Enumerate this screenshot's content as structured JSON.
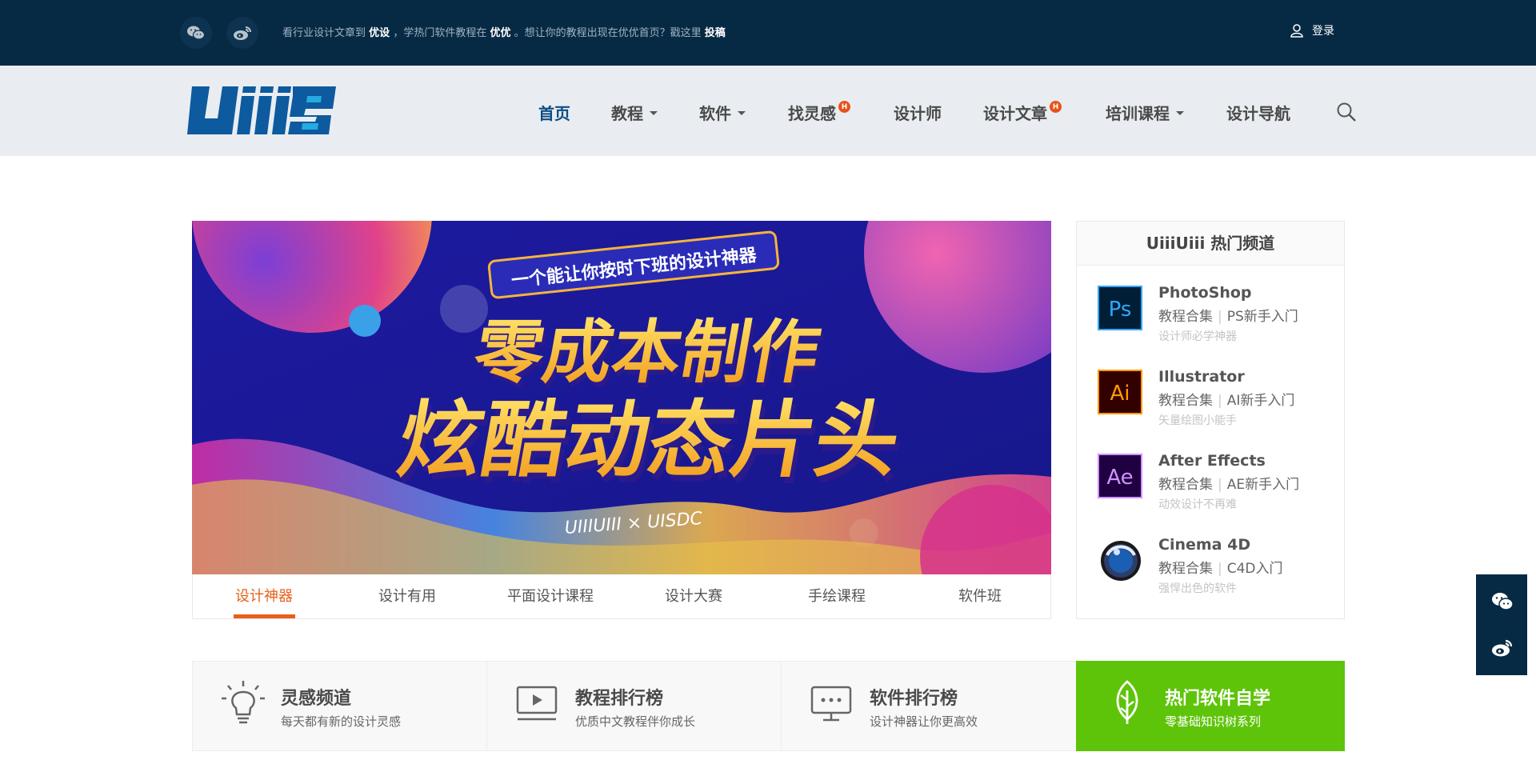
{
  "topbar": {
    "notice": {
      "p1": "看行业设计文章到",
      "b1": "优设",
      "p2": "，学热门软件教程在",
      "b2": "优优",
      "p3": "。想让你的教程出现在优优首页？戳这里",
      "b3": "投稿"
    },
    "login_label": "登录"
  },
  "nav": {
    "items": [
      {
        "label": "首页"
      },
      {
        "label": "教程"
      },
      {
        "label": "软件"
      },
      {
        "label": "找灵感"
      },
      {
        "label": "设计师"
      },
      {
        "label": "设计文章"
      },
      {
        "label": "培训课程"
      },
      {
        "label": "设计导航"
      }
    ],
    "hot_badge": "H"
  },
  "banner": {
    "top_pill": "一个能让你按时下班的设计神器",
    "line1": "零成本制作",
    "line2": "炫酷动态片头",
    "footer": "UIIIUIII × UISDC"
  },
  "tabs": [
    "设计神器",
    "设计有用",
    "平面设计课程",
    "设计大赛",
    "手绘课程",
    "软件班"
  ],
  "hot_panel": {
    "title": "UiiiUiii 热门频道",
    "channels": [
      {
        "icon_text": "Ps",
        "title": "PhotoShop",
        "link1": "教程合集",
        "link2": "PS新手入门",
        "sub": "设计师必学神器",
        "color": "#31a8ff",
        "bg": "#001e36"
      },
      {
        "icon_text": "Ai",
        "title": "Illustrator",
        "link1": "教程合集",
        "link2": "AI新手入门",
        "sub": "矢量绘图小能手",
        "color": "#ff9a00",
        "bg": "#330000"
      },
      {
        "icon_text": "Ae",
        "title": "After Effects",
        "link1": "教程合集",
        "link2": "AE新手入门",
        "sub": "动效设计不再难",
        "color": "#d291ff",
        "bg": "#1f0040"
      },
      {
        "icon_text": "",
        "title": "Cinema 4D",
        "link1": "教程合集",
        "link2": "C4D入门",
        "sub": "强悍出色的软件",
        "color": "#1a5fb4",
        "bg": "#ffffff"
      }
    ]
  },
  "cards": [
    {
      "title": "灵感频道",
      "sub": "每天都有新的设计灵感"
    },
    {
      "title": "教程排行榜",
      "sub": "优质中文教程伴你成长"
    },
    {
      "title": "软件排行榜",
      "sub": "设计神器让你更高效"
    },
    {
      "title": "热门软件自学",
      "sub": "零基础知识树系列"
    }
  ],
  "colors": {
    "topbar": "#072a44",
    "accent_orange": "#e8601c",
    "accent_green": "#5ec409",
    "nav_active": "#0d4d84"
  }
}
